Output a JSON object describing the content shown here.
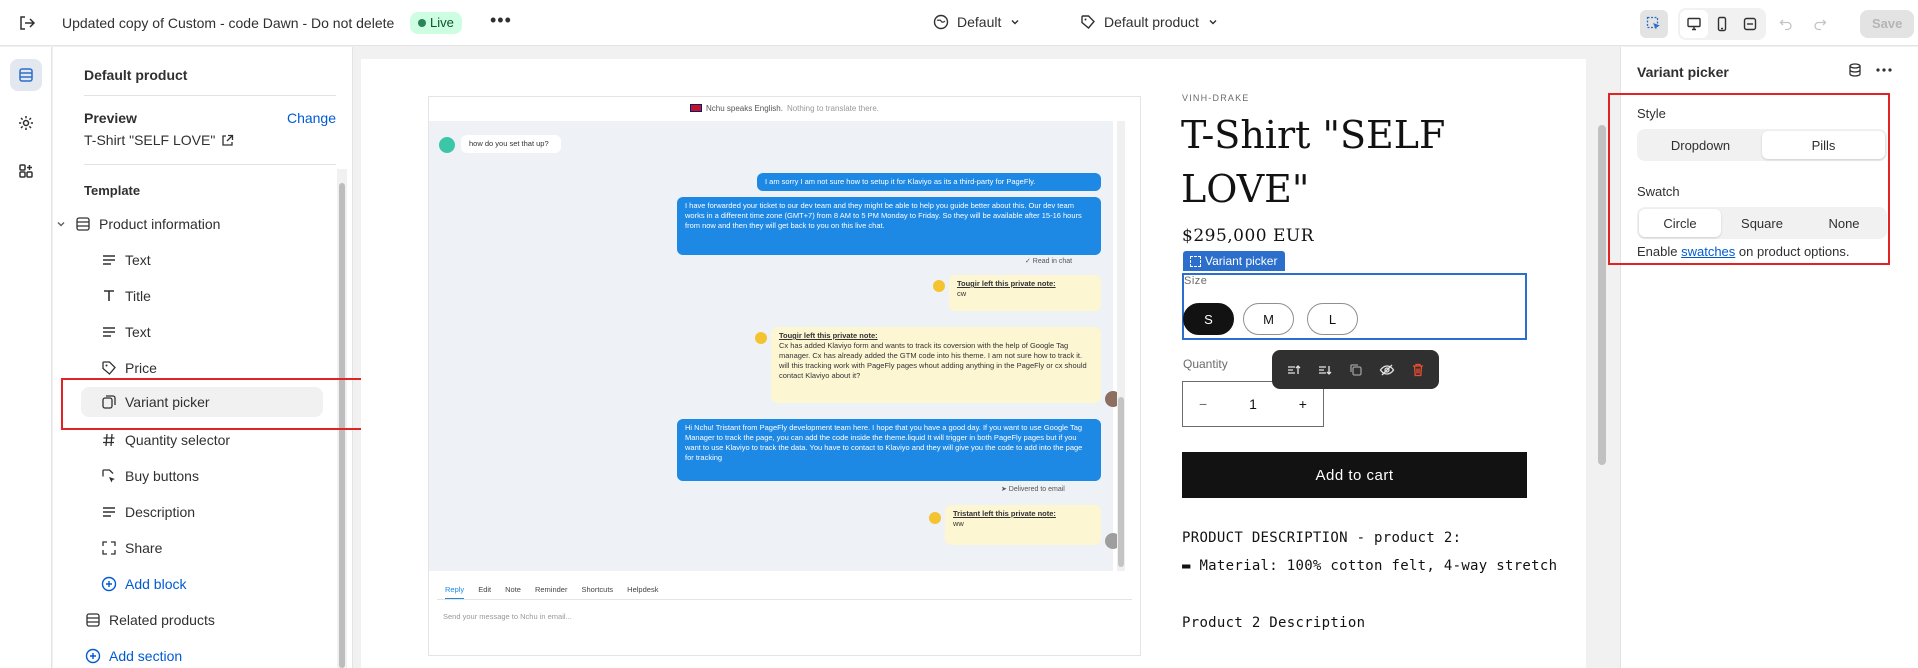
{
  "topbar": {
    "title": "Updated copy of Custom - code Dawn - Do not delete",
    "live_badge": "Live",
    "more": "•••",
    "theme_selector": "Default",
    "template_selector": "Default product",
    "save_label": "Save"
  },
  "left_panel": {
    "header": "Default product",
    "preview_label": "Preview",
    "change_label": "Change",
    "preview_product": "T-Shirt \"SELF LOVE\"",
    "template_label": "Template",
    "section_product_info": "Product information",
    "blocks": [
      {
        "label": "Text",
        "icon": "text-lines-icon"
      },
      {
        "label": "Title",
        "icon": "title-T-icon"
      },
      {
        "label": "Text",
        "icon": "text-lines-icon"
      },
      {
        "label": "Price",
        "icon": "price-tag-icon"
      },
      {
        "label": "Variant picker",
        "icon": "variant-icon"
      },
      {
        "label": "Quantity selector",
        "icon": "hash-icon"
      },
      {
        "label": "Buy buttons",
        "icon": "buy-icon"
      },
      {
        "label": "Description",
        "icon": "text-lines-icon"
      },
      {
        "label": "Share",
        "icon": "share-frame-icon"
      }
    ],
    "add_block": "Add block",
    "section_related": "Related products",
    "add_section": "Add section"
  },
  "chat_screenshot": {
    "translate_line": "Nchu speaks English.",
    "translate_note": "Nothing to translate there.",
    "msg_user": "how do you set that up?",
    "msg_agent_1": "I am sorry I am not sure how to setup it for Klaviyo as its a third-party for PageFly.",
    "msg_agent_2": "I have forwarded your ticket to our dev team and they might be able to help you guide better about this. Our dev team works in a different time zone (GMT+7) from 8 AM to 5 PM Monday to Friday. So they will be available after 15-16 hours from now and then they will get back to you on this live chat.",
    "read_status": "✓ Read in chat",
    "note_1_title": "Tougir left this private note:",
    "note_1_body": "cw",
    "note_2_title": "Tougir left this private note:",
    "note_2_body": "Cx has added Klaviyo form and wants to track its coversion with the help of Google Tag manager. Cx has already added the GTM code into his theme. I am not sure how to track it. will this tracking work with PageFly pages whout adding anything in the PageFly or cx should contact Klaviyo about it?",
    "msg_agent_3": "Hi Nchu! Tristant from PageFly development team here. I hope that you have a good day. If you want to use Google Tag Manager to track the page, you can add the code inside the theme.liquid It will trigger in both PageFly pages but if you want to use Klaviyo to track the data. You have to contact to Klaviyo and they will give you the code to add into the page for tracking",
    "delivered_status": "➤ Delivered to email",
    "note_3_title": "Tristant left this private note:",
    "note_3_body": "ww",
    "reply_tabs": [
      "Reply",
      "Edit",
      "Note",
      "Reminder",
      "Shortcuts",
      "Helpdesk"
    ],
    "reply_placeholder": "Send your message to Nchu in email..."
  },
  "product": {
    "vendor": "VINH-DRAKE",
    "title": "T-Shirt \"SELF LOVE\"",
    "price": "$295,000 EUR",
    "variant_tag": "Variant picker",
    "size_label": "Size",
    "sizes": [
      "S",
      "M",
      "L"
    ],
    "selected_size": "S",
    "quantity_label": "Quantity",
    "quantity_value": "1",
    "qty_minus": "−",
    "qty_plus": "+",
    "add_to_cart": "Add to cart",
    "desc_1": "PRODUCT DESCRIPTION - product 2:",
    "desc_2": "▬ Material: 100% cotton felt, 4-way stretch",
    "desc_3": "Product 2 Description"
  },
  "right_panel": {
    "title": "Variant picker",
    "style_label": "Style",
    "style_options": [
      "Dropdown",
      "Pills"
    ],
    "style_selected": "Pills",
    "swatch_label": "Swatch",
    "swatch_options": [
      "Circle",
      "Square",
      "None"
    ],
    "swatch_selected": "Circle",
    "help_prefix": "Enable ",
    "help_link": "swatches",
    "help_suffix": " on product options."
  },
  "colors": {
    "accent_blue": "#005bd3",
    "selection_blue": "#2c6ecb",
    "highlight_red": "#e02424",
    "live_green": "#cdfee1"
  }
}
